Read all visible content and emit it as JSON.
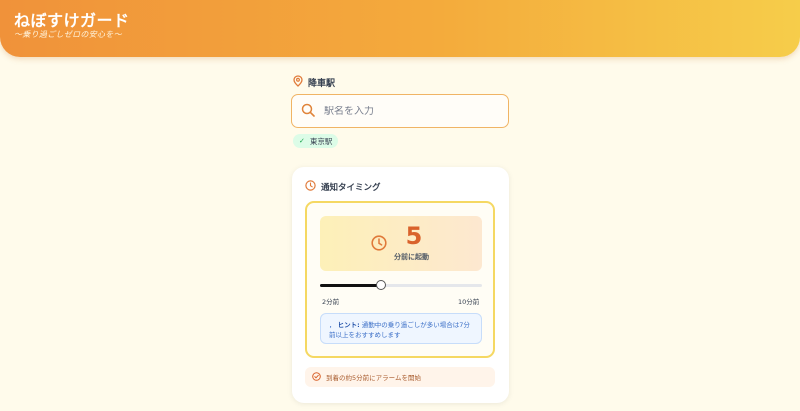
{
  "header": {
    "title": "ねぼすけガード",
    "subtitle": "〜乗り過ごしゼロの安心を〜"
  },
  "station": {
    "label": "降車駅",
    "placeholder": "駅名を入力",
    "selected": "東京駅"
  },
  "timing": {
    "title": "通知タイミング",
    "minutes": "5",
    "minutes_caption": "分前に起動",
    "slider": {
      "value": 5,
      "min": 2,
      "max": 10,
      "min_label": "2分前",
      "max_label": "10分前"
    },
    "hint_prefix": "，",
    "hint_label": "ヒント:",
    "hint_text": "通勤中の乗り過ごしが多い場合は7分前以上をおすすめします",
    "footer_note": "到着の約5分前にアラームを開始"
  },
  "colors": {
    "accent": "#f0923a",
    "number": "#d9622b",
    "chip_bg": "#dcfce7",
    "hint_bg": "#eff6ff"
  },
  "icons": {
    "station": "map-pin-icon",
    "search": "search-icon",
    "check": "check-icon",
    "timing": "clock-icon",
    "display": "clock-icon",
    "footer": "check-circle-icon"
  }
}
